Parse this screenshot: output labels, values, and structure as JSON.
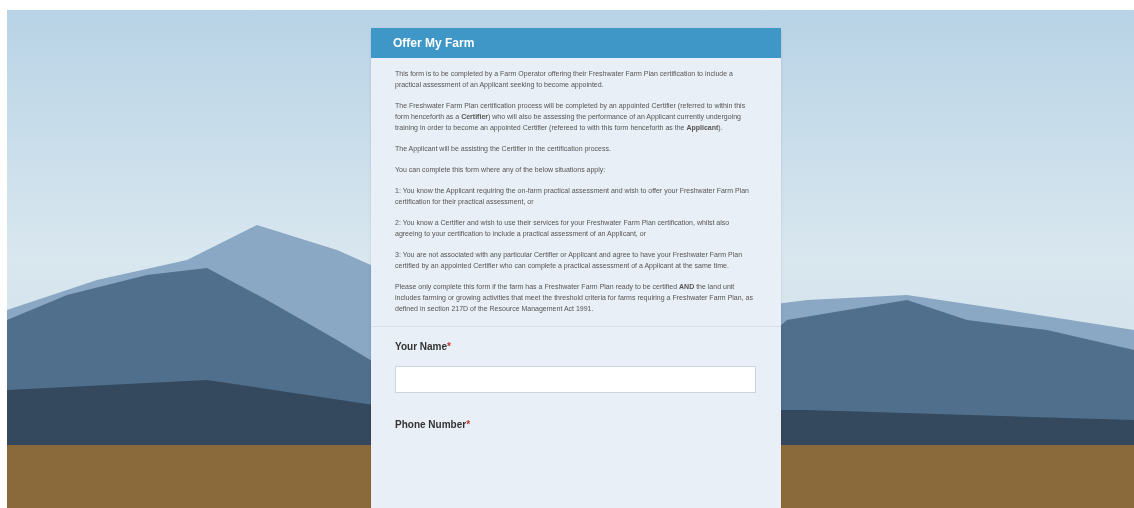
{
  "form": {
    "title": "Offer My Farm",
    "intro": [
      "This form is to be completed by a Farm Operator offering their Freshwater Farm Plan certification to include a practical assessment of an Applicant seeking to become appointed.",
      "The Freshwater Farm Plan certification process will be completed by an appointed Certifier (referred to within this form henceforth as a **Certifier**) who will also be assessing the performance of an Applicant currently undergoing training in order to become an appointed Certifier (refereed to with this form henceforth as the **Applicant**).",
      "The Applicant will be assisting the Certifier in the certification process.",
      "You can complete this form where any of the below situations apply:",
      "1: You know the Applicant requiring the on-farm practical assessment and wish to offer your Freshwater Farm Plan certification for their practical assessment, or",
      "2: You know a Certifier and wish to use their services for your Freshwater Farm Plan certification, whilst also agreeing to your certification to include a practical assessment of an Applicant, or",
      "3: You are not associated with any particular Certifier or Applicant and agree to have your Freshwater Farm Plan certified by an appointed Certifier who can complete a practical assessment of a Applicant at the same time.",
      "Please only complete this form if the farm has a Freshwater Farm Plan ready to be certified **AND** the land unit includes farming or growing activities that meet the threshold criteria for farms requiring a Freshwater Farm Plan, as defined in section 217D of the Resource Management Act 1991."
    ],
    "fields": [
      {
        "label": "Your Name",
        "required_mark": "*",
        "kind": "text"
      },
      {
        "label": "Phone Number",
        "required_mark": "*",
        "kind": "label_only"
      }
    ]
  }
}
